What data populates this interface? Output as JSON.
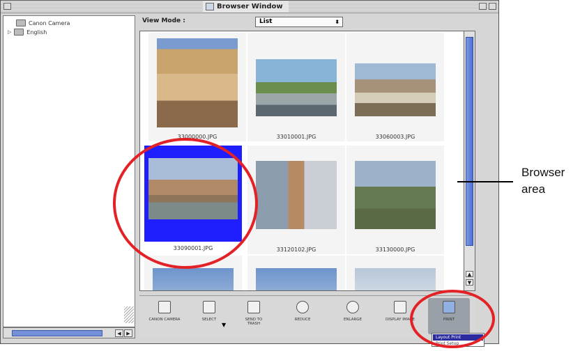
{
  "window": {
    "title": "Browser Window"
  },
  "tree": {
    "items": [
      {
        "label": "Canon Camera"
      },
      {
        "label": "English"
      }
    ]
  },
  "view_mode": {
    "label": "View Mode :",
    "value": "List"
  },
  "thumbnails": [
    {
      "filename": "33000000.JPG",
      "selected": false
    },
    {
      "filename": "33010001.JPG",
      "selected": false
    },
    {
      "filename": "33060003.JPG",
      "selected": false
    },
    {
      "filename": "33090001.JPG",
      "selected": true
    },
    {
      "filename": "33120102.JPG",
      "selected": false
    },
    {
      "filename": "33130000.JPG",
      "selected": false
    },
    {
      "filename": "",
      "selected": false
    },
    {
      "filename": "",
      "selected": false
    },
    {
      "filename": "",
      "selected": false
    }
  ],
  "toolbar": {
    "buttons": [
      {
        "label": "CANON CAMERA",
        "icon": "camera-icon"
      },
      {
        "label": "SELECT",
        "icon": "select-icon"
      },
      {
        "label": "SEND TO TRASH",
        "icon": "trash-icon"
      },
      {
        "label": "REDUCE",
        "icon": "zoom-out-icon"
      },
      {
        "label": "ENLARGE",
        "icon": "zoom-in-icon"
      },
      {
        "label": "DISPLAY IMAGE",
        "icon": "display-image-icon"
      },
      {
        "label": "PRINT",
        "icon": "printer-icon"
      }
    ],
    "print_menu": [
      "Layout Print",
      "Print Setup"
    ]
  },
  "annotation": {
    "label_line1": "Browser",
    "label_line2": "area"
  },
  "colors": {
    "selection": "#1e1eff",
    "scroll_thumb": "#5f7fd6",
    "annotation_ring": "#e32227"
  }
}
